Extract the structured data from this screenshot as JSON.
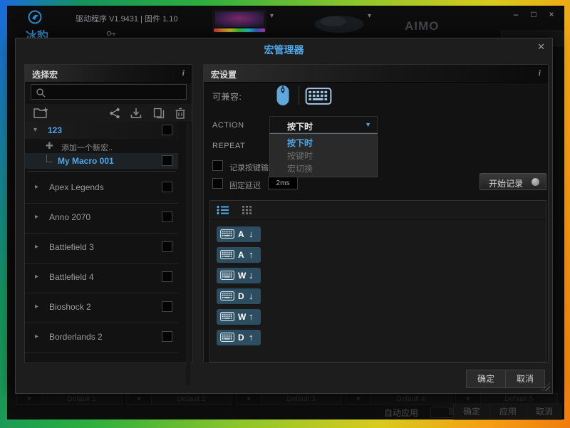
{
  "titlebar": {
    "app_title": "驱动程序 V1.9431 | 固件 1.10",
    "minimize": "–",
    "maximize": "□",
    "close": "×",
    "brand": "冰豹",
    "aimo": "AIMO"
  },
  "dialog": {
    "title": "宏管理器",
    "close": "✕",
    "select_macro": {
      "header": "选择宏",
      "info": "i",
      "group_name": "123",
      "add_new_label": "添加一个新宏..",
      "macro_name": "My Macro 001",
      "games": [
        "Apex Legends",
        "Anno 2070",
        "Battlefield 3",
        "Battlefield 4",
        "Bioshock 2",
        "Borderlands 2"
      ]
    },
    "macro_settings": {
      "header": "宏设置",
      "info": "i",
      "compatible_label": "可兼容:",
      "action_label": "ACTION",
      "repeat_label": "REPEAT",
      "dropdown": {
        "selected": "按下时",
        "options": [
          "按下时",
          "按键时",
          "宏切换"
        ]
      },
      "record_input_label": "记录按键输入",
      "fixed_delay_label": "固定延迟",
      "fixed_delay_value": "2ms",
      "start_record": "开始记录",
      "events": [
        {
          "key": "A",
          "dir": "↓"
        },
        {
          "key": "A",
          "dir": "↑"
        },
        {
          "key": "W",
          "dir": "↓"
        },
        {
          "key": "D",
          "dir": "↓"
        },
        {
          "key": "W",
          "dir": "↑"
        },
        {
          "key": "D",
          "dir": "↑"
        }
      ]
    },
    "buttons": {
      "ok": "确定",
      "cancel": "取消"
    }
  },
  "footer": {
    "auto_apply": "自动应用",
    "ok": "确定",
    "apply": "应用",
    "cancel": "取消"
  },
  "profiles": [
    "Default 1",
    "Default 2",
    "Default 3",
    "Default 4",
    "Default 5"
  ],
  "colors": {
    "accent": "#4fa8e8",
    "chip": "#2d4d61"
  }
}
